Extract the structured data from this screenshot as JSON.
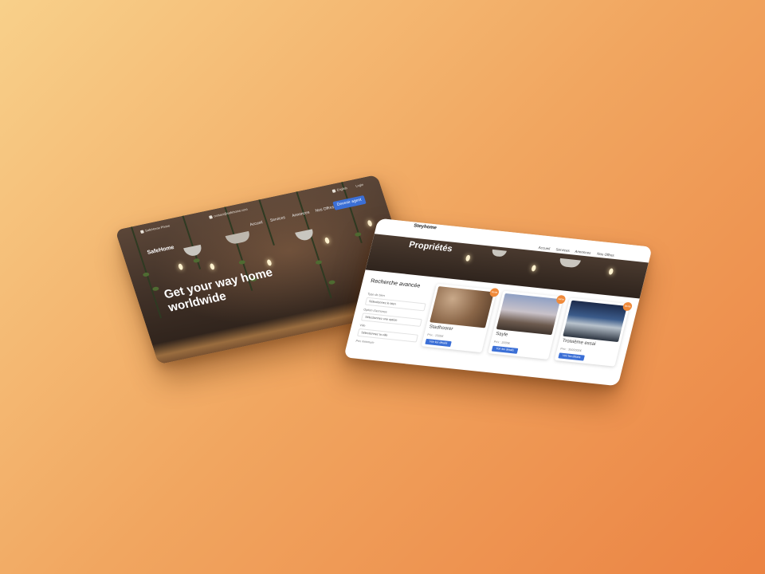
{
  "left_site": {
    "contact_phone": "SafeHome Phone",
    "contact_email": "contact@safehome.com",
    "language": "English",
    "login": "Login",
    "brand": "SafeHome",
    "nav": [
      "Accueil",
      "Services",
      "Annonces",
      "Nos Offres"
    ],
    "cta": "Devenir agent",
    "hero_title": "Get your way home worldwide"
  },
  "right_site": {
    "brand": "Steyhome",
    "nav": [
      "Accueil",
      "Services",
      "Annonces",
      "Nos Offres"
    ],
    "banner_title": "Propriétés",
    "search": {
      "title": "Recherche avancée",
      "fields": [
        {
          "label": "Type de bien",
          "value": "Sélectionnez le bien"
        },
        {
          "label": "Option d'annonce",
          "value": "Sélectionnez une option"
        },
        {
          "label": "Ville",
          "value": "Sélectionnez la ville"
        },
        {
          "label": "Prix minimum",
          "value": ""
        }
      ]
    },
    "properties": [
      {
        "title": "Stadhoorer",
        "subtitle": "Prix : 1500€",
        "button": "Voir les détails",
        "badge": "Vente",
        "image": "beach-sand-image"
      },
      {
        "title": "Sayle",
        "subtitle": "Prix : 2000€",
        "button": "Voir les détails",
        "badge": "Vente",
        "image": "statue-sky-image"
      },
      {
        "title": "Troisième essai",
        "subtitle": "Prix : 3500000€",
        "button": "Voir les détails",
        "badge": "Vente",
        "image": "modern-house-image"
      }
    ]
  },
  "colors": {
    "background_start": "#f8d08a",
    "background_end": "#eb8343",
    "accent_blue": "#3b6fd6",
    "badge_orange": "#f08a3a"
  }
}
